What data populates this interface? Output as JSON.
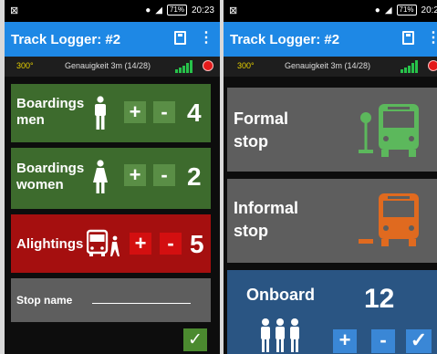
{
  "screens": [
    {
      "status_time": "20:23",
      "battery": "71%",
      "app_title": "Track Logger: #2",
      "heading": "300°",
      "accuracy": "Genauigkeit 3m (14/28)",
      "boardings_men": {
        "label_line1": "Boardings",
        "label_line2": "men",
        "plus": "+",
        "minus": "-",
        "count": "4"
      },
      "boardings_women": {
        "label_line1": "Boardings",
        "label_line2": "women",
        "plus": "+",
        "minus": "-",
        "count": "2"
      },
      "alightings": {
        "label": "Alightings",
        "plus": "+",
        "minus": "-",
        "count": "5"
      },
      "stop_name_label": "Stop name",
      "confirm_icon": "✓"
    },
    {
      "status_time": "20:2",
      "battery": "71%",
      "app_title": "Track Logger: #2",
      "heading": "300°",
      "accuracy": "Genauigkeit 3m (14/28)",
      "formal_stop": {
        "line1": "Formal",
        "line2": "stop"
      },
      "informal_stop": {
        "line1": "Informal",
        "line2": "stop"
      },
      "onboard": {
        "label": "Onboard",
        "count": "12",
        "plus": "+",
        "minus": "-",
        "confirm": "✓"
      }
    }
  ],
  "colors": {
    "appbar": "#1e88e5",
    "green_panel": "#3d6b2d",
    "red_panel": "#a50f0f",
    "gray_panel": "#5e5e5e",
    "blue_panel": "#2a5583",
    "bus_green": "#5cb85c",
    "bus_orange": "#e06a1f"
  },
  "icons": [
    "save-icon",
    "overflow-menu-icon",
    "man-icon",
    "woman-icon",
    "bus-alighting-icon",
    "bus-stop-sign-icon",
    "bus-icon",
    "people-icon",
    "check-icon"
  ]
}
